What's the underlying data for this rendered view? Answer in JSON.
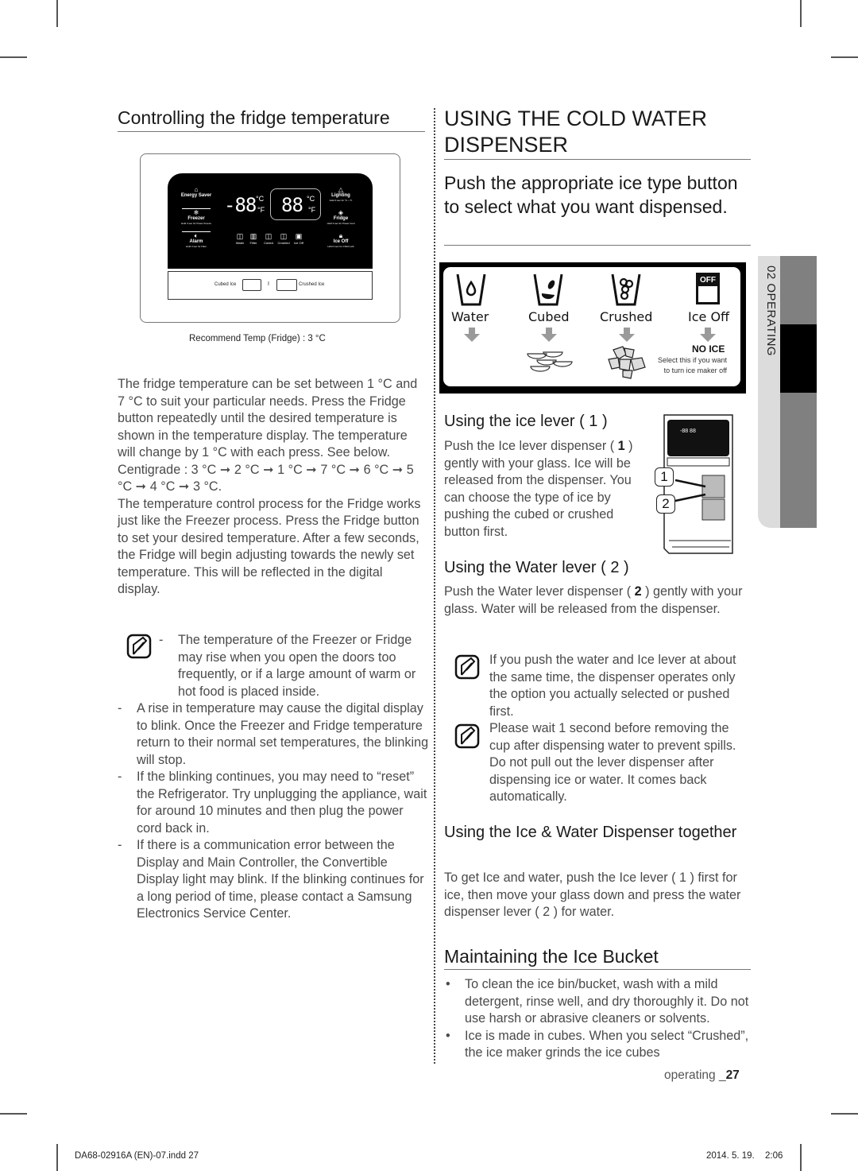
{
  "left_column": {
    "heading": "Controlling the fridge temperature",
    "panel_figure": {
      "left_labels": [
        {
          "title": "Energy Saver",
          "sub": ""
        },
        {
          "title": "Freezer",
          "sub": "Hold 3 sec for Power Freeze"
        },
        {
          "title": "Alarm",
          "sub": "Hold 3 sec for Filter"
        }
      ],
      "right_labels": [
        {
          "title": "Lighting",
          "sub": "Hold 3 sec for °C↔°F"
        },
        {
          "title": "Fridge",
          "sub": "Hold 3 sec for Power Cool"
        },
        {
          "title": "Ice Off",
          "sub": "Hold 3 sec for Child Lock"
        }
      ],
      "freezer_display": "-88",
      "fridge_display": "88",
      "unit_c": "°C",
      "unit_f": "°F",
      "mode_icons": [
        "Water",
        "Filter",
        "Cubed",
        "Crushed",
        "Ice Off"
      ],
      "lower_left_label": "Cubed Ice",
      "lower_separator": "I",
      "lower_right_label": "Crushed Ice"
    },
    "caption": "Recommend Temp (Fridge) : 3 °C",
    "para1": "The fridge temperature can be set between 1 °C and 7 °C to suit your particular needs. Press the Fridge button repeatedly until the desired temperature is shown in the temperature display. The temperature will change by 1 °C with each press. See below.",
    "centigrade_sequence": "Centigrade : 3 °C ➞ 2 °C ➞ 1 °C ➞ 7 °C ➞ 6 °C ➞ 5 °C ➞ 4 °C ➞ 3 °C.",
    "para2": "The temperature control process for the Fridge works just like the Freezer process. Press the Fridge button to set your desired temperature. After a few seconds, the Fridge will begin adjusting towards the newly set temperature. This will be reflected in the digital display.",
    "notes": [
      "The temperature of the Freezer or Fridge may rise when you open the doors too frequently, or if a large amount of warm or hot food is placed inside.",
      "A rise in temperature may cause the digital display to blink. Once the Freezer and Fridge temperature return to their normal set temperatures, the blinking will stop.",
      "If the blinking continues, you may need to “reset” the Refrigerator. Try unplugging the appliance, wait for around 10 minutes and then plug the power cord back in.",
      "If there is a communication error between the Display and Main Controller, the Convertible Display light may blink. If the blinking continues for a long period of time, please contact a Samsung Electronics Service Center."
    ]
  },
  "right_column": {
    "heading_line1": "USING THE COLD WATER",
    "heading_line2": "DISPENSER",
    "subheading": "Push the appropriate ice type button to select what you want dispensed.",
    "ice_figure": {
      "options": [
        "Water",
        "Cubed",
        "Crushed",
        "Ice Off"
      ],
      "off_badge": "OFF",
      "no_ice_title": "NO ICE",
      "no_ice_line1": "Select this if you want",
      "no_ice_line2": "to turn ice maker off"
    },
    "ice_lever": {
      "heading": "Using the ice lever ( 1 )",
      "text_before": "Push the Ice lever dispenser ( ",
      "num": "1",
      "text_after": " ) gently with your glass. Ice will be released from the dispenser. You can choose the type of ice by pushing the cubed or crushed button first.",
      "callouts": [
        "1",
        "2"
      ]
    },
    "water_lever": {
      "heading": "Using the Water lever ( 2 )",
      "text_before": "Push the Water lever dispenser ( ",
      "num": "2",
      "text_after": " ) gently with your glass. Water will be released from the dispenser."
    },
    "notes": [
      "If you push the water and Ice lever at about the same time, the dispenser operates only the option you actually selected or pushed first.",
      "Please wait 1 second before removing the cup after dispensing water to prevent spills. Do not pull out the lever dispenser after dispensing ice or water. It comes back automatically."
    ],
    "together": {
      "heading": "Using the Ice & Water Dispenser together",
      "text": "To get Ice and water, push the Ice lever ( 1 ) first for ice, then move your glass down and press the water dispenser lever ( 2 ) for water."
    },
    "bucket": {
      "heading": "Maintaining the Ice Bucket",
      "bullet_char": "•",
      "bullets": [
        "To clean the ice bin/bucket, wash with a mild detergent, rinse well, and dry thoroughly it. Do not use harsh or abrasive cleaners or solvents.",
        "Ice is made in cubes. When you select “Crushed”, the ice maker grinds the ice cubes"
      ]
    }
  },
  "side_tab": {
    "label": "02  OPERATING"
  },
  "page_footer": {
    "section": "operating _",
    "page": "27"
  },
  "print_slug": {
    "file": "DA68-02916A (EN)-07.indd   27",
    "date": "2014. 5. 19.",
    "time": "2:06"
  },
  "colors": {
    "heading": "#1a1a1a",
    "body": "#4a4a4a",
    "side_dark": "#808080",
    "side_light": "#dcdcdc",
    "arrow_gray": "#9a9a9a"
  }
}
